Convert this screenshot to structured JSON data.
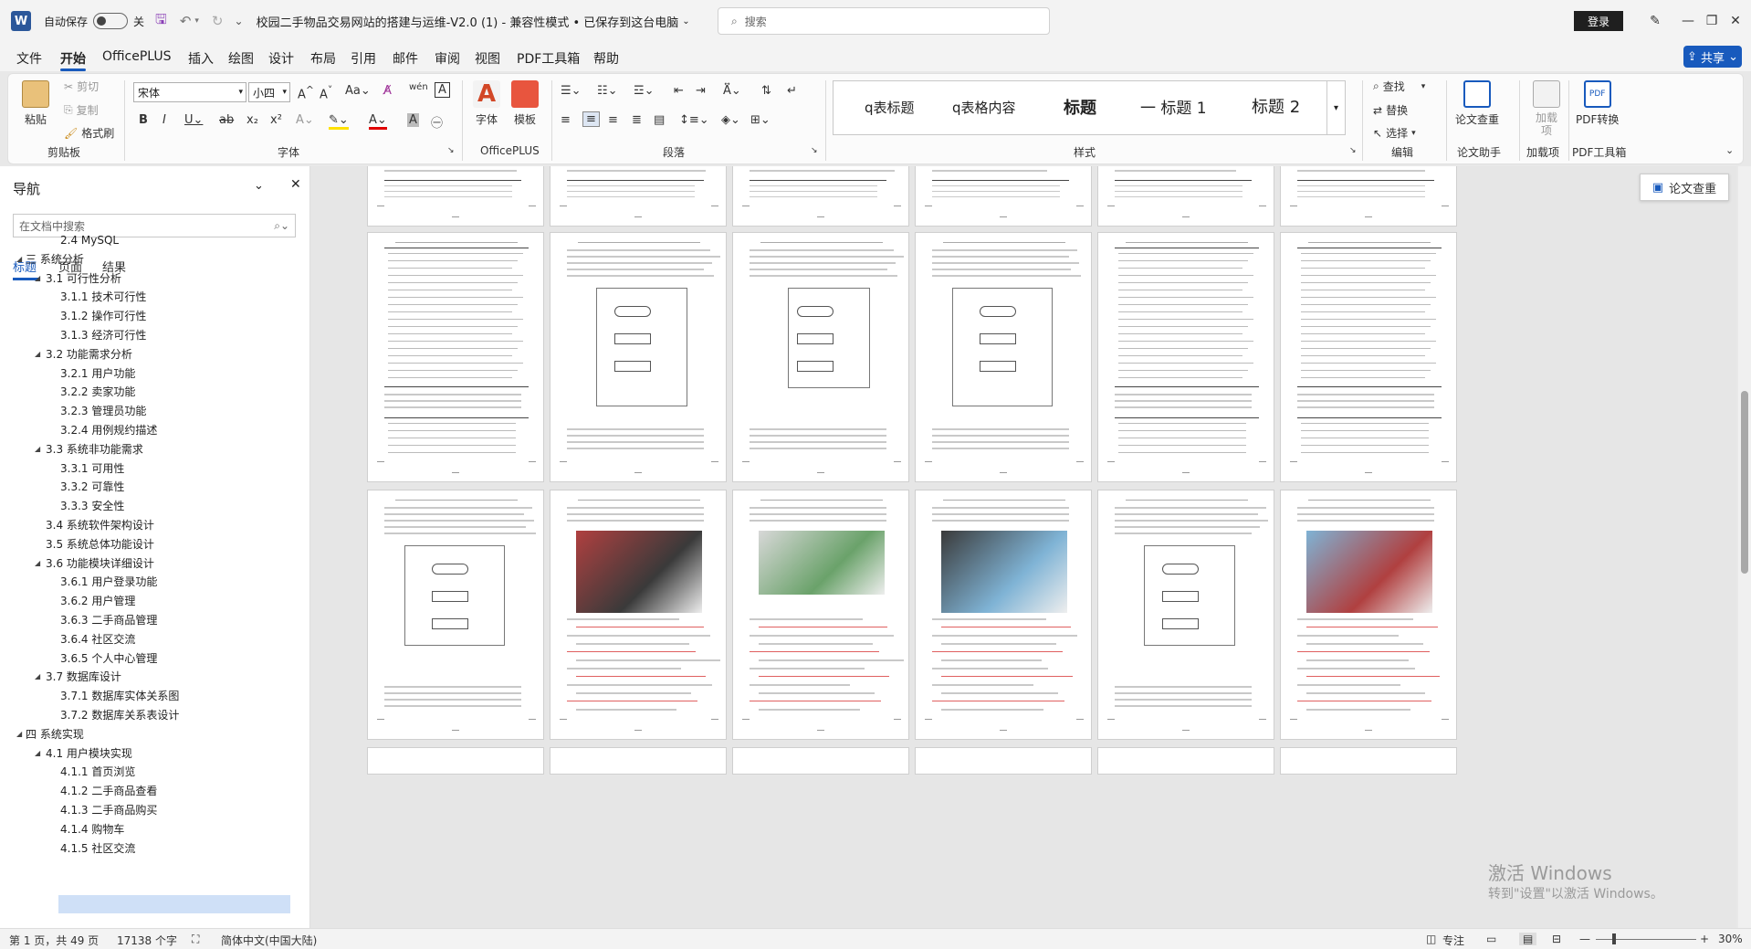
{
  "titlebar": {
    "autosave_label": "自动保存",
    "autosave_state": "关",
    "doc_title": "校园二手物品交易网站的搭建与运维-V2.0 (1)  -  兼容性模式 • 已保存到这台电脑",
    "search_placeholder": "搜索",
    "login_label": "登录"
  },
  "menu": {
    "items": [
      "文件",
      "开始",
      "OfficePLUS",
      "插入",
      "绘图",
      "设计",
      "布局",
      "引用",
      "邮件",
      "审阅",
      "视图",
      "PDF工具箱",
      "帮助"
    ],
    "active": "开始",
    "share_label": "共享"
  },
  "ribbon": {
    "clipboard": {
      "paste": "粘贴",
      "cut": "剪切",
      "copy": "复制",
      "format_painter": "格式刷",
      "label": "剪贴板"
    },
    "font": {
      "name": "宋体",
      "size": "小四",
      "label": "字体"
    },
    "officeplus": {
      "font_btn": "字体",
      "template_btn": "模板",
      "label": "OfficePLUS"
    },
    "paragraph": {
      "label": "段落"
    },
    "styles": {
      "items": [
        "q表标题",
        "q表格内容",
        "标题",
        "一 标题 1",
        "标题 2"
      ],
      "label": "样式"
    },
    "editing": {
      "find": "查找",
      "replace": "替换",
      "select": "选择",
      "label": "编辑"
    },
    "thesis": {
      "check": "论文查重",
      "label": "论文助手"
    },
    "addins": {
      "btn": "加载项",
      "label": "加载项"
    },
    "pdf": {
      "btn": "PDF转换",
      "label": "PDF工具箱"
    }
  },
  "nav": {
    "title": "导航",
    "search_placeholder": "在文档中搜索",
    "tabs": [
      "标题",
      "页面",
      "结果"
    ],
    "items": [
      {
        "text": "2.4 MySQL",
        "level": 2,
        "exp": ""
      },
      {
        "text": "三 系统分析",
        "level": 0,
        "exp": "◢"
      },
      {
        "text": "3.1 可行性分析",
        "level": 1,
        "exp": "◢"
      },
      {
        "text": "3.1.1 技术可行性",
        "level": 2,
        "exp": ""
      },
      {
        "text": "3.1.2 操作可行性",
        "level": 2,
        "exp": ""
      },
      {
        "text": "3.1.3 经济可行性",
        "level": 2,
        "exp": ""
      },
      {
        "text": "3.2 功能需求分析",
        "level": 1,
        "exp": "◢"
      },
      {
        "text": "3.2.1 用户功能",
        "level": 2,
        "exp": ""
      },
      {
        "text": "3.2.2 卖家功能",
        "level": 2,
        "exp": ""
      },
      {
        "text": "3.2.3 管理员功能",
        "level": 2,
        "exp": ""
      },
      {
        "text": "3.2.4 用例规约描述",
        "level": 2,
        "exp": ""
      },
      {
        "text": "3.3 系统非功能需求",
        "level": 1,
        "exp": "◢"
      },
      {
        "text": "3.3.1 可用性",
        "level": 2,
        "exp": ""
      },
      {
        "text": "3.3.2 可靠性",
        "level": 2,
        "exp": ""
      },
      {
        "text": "3.3.3 安全性",
        "level": 2,
        "exp": ""
      },
      {
        "text": "3.4 系统软件架构设计",
        "level": 1,
        "exp": ""
      },
      {
        "text": "3.5 系统总体功能设计",
        "level": 1,
        "exp": ""
      },
      {
        "text": "3.6 功能模块详细设计",
        "level": 1,
        "exp": "◢"
      },
      {
        "text": "3.6.1 用户登录功能",
        "level": 2,
        "exp": ""
      },
      {
        "text": "3.6.2 用户管理",
        "level": 2,
        "exp": ""
      },
      {
        "text": "3.6.3 二手商品管理",
        "level": 2,
        "exp": ""
      },
      {
        "text": "3.6.4 社区交流",
        "level": 2,
        "exp": ""
      },
      {
        "text": "3.6.5 个人中心管理",
        "level": 2,
        "exp": ""
      },
      {
        "text": "3.7 数据库设计",
        "level": 1,
        "exp": "◢"
      },
      {
        "text": "3.7.1 数据库实体关系图",
        "level": 2,
        "exp": ""
      },
      {
        "text": "3.7.2 数据库关系表设计",
        "level": 2,
        "exp": ""
      },
      {
        "text": "四 系统实现",
        "level": 0,
        "exp": "◢"
      },
      {
        "text": "4.1 用户模块实现",
        "level": 1,
        "exp": "◢"
      },
      {
        "text": "4.1.1 首页浏览",
        "level": 2,
        "exp": ""
      },
      {
        "text": "4.1.2 二手商品查看",
        "level": 2,
        "exp": ""
      },
      {
        "text": "4.1.3 二手商品购买",
        "level": 2,
        "exp": ""
      },
      {
        "text": "4.1.4 购物车",
        "level": 2,
        "exp": ""
      },
      {
        "text": "4.1.5 社区交流",
        "level": 2,
        "exp": "",
        "selected": true
      }
    ]
  },
  "document": {
    "thesis_check_button": "论文查重",
    "watermark_line1": "激活 Windows",
    "watermark_line2": "转到\"设置\"以激活 Windows。"
  },
  "statusbar": {
    "page": "第 1 页，共 49 页",
    "words": "17138 个字",
    "language": "简体中文(中国大陆)",
    "focus": "专注",
    "zoom": "30%"
  },
  "colors": {
    "accent": "#185abd",
    "word_blue": "#2b579a",
    "nav_selected": "#cfe0f7"
  }
}
